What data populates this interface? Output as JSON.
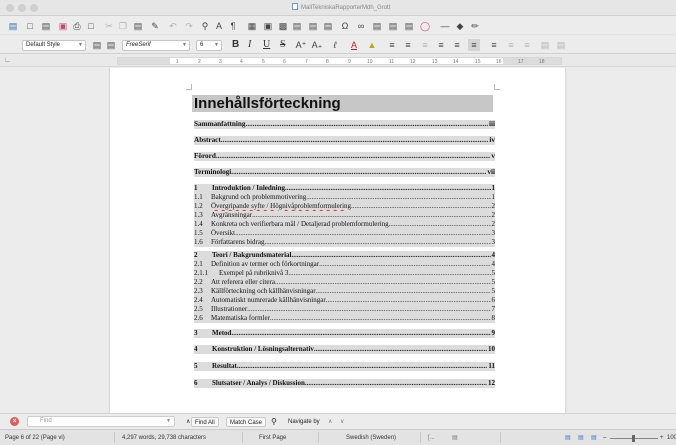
{
  "window": {
    "title": "MallTekniskaRapporterMdh_Grott",
    "active_icon": "document-icon"
  },
  "toolbar": {
    "paragraph_style": "Default Style",
    "font_name": "FreeSerif",
    "font_size": "6",
    "format_buttons": [
      "B",
      "I",
      "U",
      "S"
    ]
  },
  "ruler": {
    "numbers": [
      "1",
      "2",
      "3",
      "4",
      "5",
      "6",
      "7",
      "8",
      "9",
      "10",
      "11",
      "12",
      "13",
      "14",
      "15",
      "16",
      "17",
      "18"
    ]
  },
  "document": {
    "heading": "Innehållsförteckning",
    "entries": [
      {
        "kind": "top",
        "num": "",
        "text": "Sammanfattning",
        "page": "iii"
      },
      {
        "kind": "top",
        "num": "",
        "text": "Abstract",
        "page": "iv"
      },
      {
        "kind": "top",
        "num": "",
        "text": "Förord",
        "page": "v"
      },
      {
        "kind": "top",
        "num": "",
        "text": "Terminologi",
        "page": "vii"
      },
      {
        "kind": "ch",
        "num": "1",
        "text": "Introduktion / Inledning",
        "page": "1"
      },
      {
        "kind": "sub",
        "num": "1.1",
        "text": "Bakgrund och problemmotivering",
        "page": "1"
      },
      {
        "kind": "sub",
        "num": "1.2",
        "text": "Övergripande syfte / Högnivåproblemformulering",
        "page": "2"
      },
      {
        "kind": "sub",
        "num": "1.3",
        "text": "Avgränsningar",
        "page": "2"
      },
      {
        "kind": "sub",
        "num": "1.4",
        "text": "Konkreta och verifierbara mål / Detaljerad problemformulering",
        "page": "2"
      },
      {
        "kind": "sub",
        "num": "1.5",
        "text": "Översikt",
        "page": "3"
      },
      {
        "kind": "sub",
        "num": "1.6",
        "text": "Författarens bidrag",
        "page": "3"
      },
      {
        "kind": "ch",
        "num": "2",
        "text": "Teori / Bakgrundsmaterial",
        "page": "4"
      },
      {
        "kind": "sub",
        "num": "2.1",
        "text": "Definition av termer och förkortningar",
        "page": "4"
      },
      {
        "kind": "sub3",
        "num": "2.1.1",
        "text": "Exempel på rubriknivå 3",
        "page": "5"
      },
      {
        "kind": "sub",
        "num": "2.2",
        "text": "Att referera eller citera",
        "page": "5"
      },
      {
        "kind": "sub",
        "num": "2.3",
        "text": "Källförteckning och källhänvisningar",
        "page": "5"
      },
      {
        "kind": "sub",
        "num": "2.4",
        "text": "Automatiskt numrerade källhänvisningar",
        "page": "6"
      },
      {
        "kind": "sub",
        "num": "2.5",
        "text": "Illustrationer",
        "page": "7"
      },
      {
        "kind": "sub",
        "num": "2.6",
        "text": "Matematiska formler",
        "page": "8"
      },
      {
        "kind": "ch",
        "num": "3",
        "text": "Metod",
        "page": "9"
      },
      {
        "kind": "ch",
        "num": "4",
        "text": "Konstruktion / Lösningsalternativ",
        "page": "10"
      },
      {
        "kind": "ch",
        "num": "5",
        "text": "Resultat",
        "page": "11"
      },
      {
        "kind": "ch",
        "num": "6",
        "text": "Slutsatser / Analys / Diskussion",
        "page": "12"
      }
    ]
  },
  "findbar": {
    "placeholder": "Find",
    "find_all": "Find All",
    "match_case": "Match Case",
    "navigate_by": "Navigate by"
  },
  "statusbar": {
    "page_info": "Page 6 of 22 (Page vi)",
    "word_count": "4,297 words, 29,738 characters",
    "page_style": "First Page",
    "language": "Swedish (Sweden)",
    "zoom": "100%"
  }
}
